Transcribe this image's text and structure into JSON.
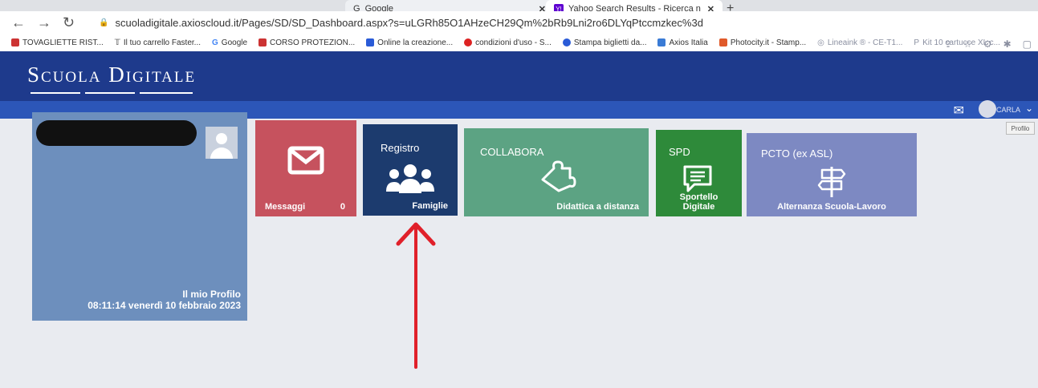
{
  "browser": {
    "tabs": [
      {
        "label": "Google"
      },
      {
        "label": "Yahoo Search Results - Ricerca n"
      }
    ],
    "new_tab": "+",
    "url": "scuoladigitale.axioscloud.it/Pages/SD/SD_Dashboard.aspx?s=uLGRh85O1AHzeCH29Qm%2bRb9Lni2ro6DLYqPtccmzkec%3d",
    "bookmarks": [
      {
        "label": "TOVAGLIETTE RIST..."
      },
      {
        "label": "Il tuo carrello Faster..."
      },
      {
        "label": "Google"
      },
      {
        "label": "CORSO PROTEZION..."
      },
      {
        "label": "Online la creazione..."
      },
      {
        "label": "condizioni d'uso - S..."
      },
      {
        "label": "Stampa biglietti da..."
      },
      {
        "label": "Axios Italia"
      },
      {
        "label": "Photocity.it - Stamp..."
      },
      {
        "label": "Lineaink ® - CE-T1..."
      },
      {
        "label": "Kit 10 cartucce XL c..."
      }
    ]
  },
  "header": {
    "logo": "Scuola Digitale",
    "user_name": "CARLA",
    "tooltip": "Profilo"
  },
  "profile": {
    "label": "Il mio Profilo",
    "datetime": "08:11:14 venerdì 10 febbraio 2023"
  },
  "tiles": {
    "messaggi": {
      "label": "Messaggi",
      "count": "0",
      "color": "#c6525e"
    },
    "registro": {
      "title": "Registro",
      "label": "Famiglie",
      "color": "#1c3b6e"
    },
    "collabora": {
      "title": "COLLABORA",
      "label": "Didattica a distanza",
      "color": "#5ca383"
    },
    "spd": {
      "title": "SPD",
      "label_line1": "Sportello",
      "label_line2": "Digitale",
      "color": "#2e8a3a"
    },
    "pcto": {
      "title": "PCTO (ex ASL)",
      "label": "Alternanza Scuola-Lavoro",
      "color": "#7d89c2"
    }
  },
  "annotation": {
    "color": "#e0202a"
  }
}
